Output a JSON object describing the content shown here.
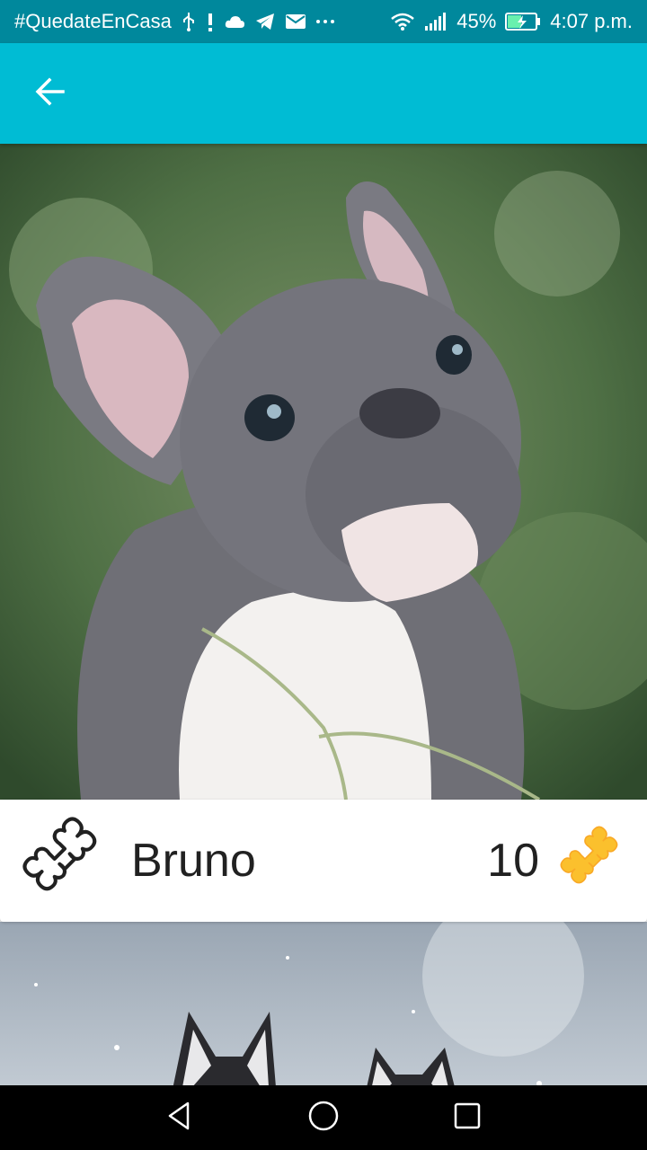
{
  "status_bar": {
    "hashtag": "#QuedateEnCasa",
    "battery": "45%",
    "time": "4:07 p.m.",
    "icons": [
      "usb-icon",
      "alert-icon",
      "cloud-icon",
      "telegram-icon",
      "mail-icon",
      "more-icon",
      "wifi-icon",
      "signal-icon",
      "battery-charging-icon"
    ]
  },
  "app_bar": {
    "color": "#00bcd4",
    "back_icon": "arrow-back-icon"
  },
  "pets": [
    {
      "name": "Bruno",
      "likes": "10",
      "image": "french-bulldog-puppy-photo",
      "like_icon": "bone-outline-icon",
      "count_icon": "bone-filled-icon"
    },
    {
      "image": "husky-dogs-snow-photo"
    }
  ],
  "colors": {
    "status_bar": "#00889c",
    "accent": "#00bcd4",
    "bone_filled": "#fbc02d"
  },
  "nav_bar": {
    "icons": [
      "back-triangle-icon",
      "home-circle-icon",
      "recents-square-icon"
    ]
  }
}
